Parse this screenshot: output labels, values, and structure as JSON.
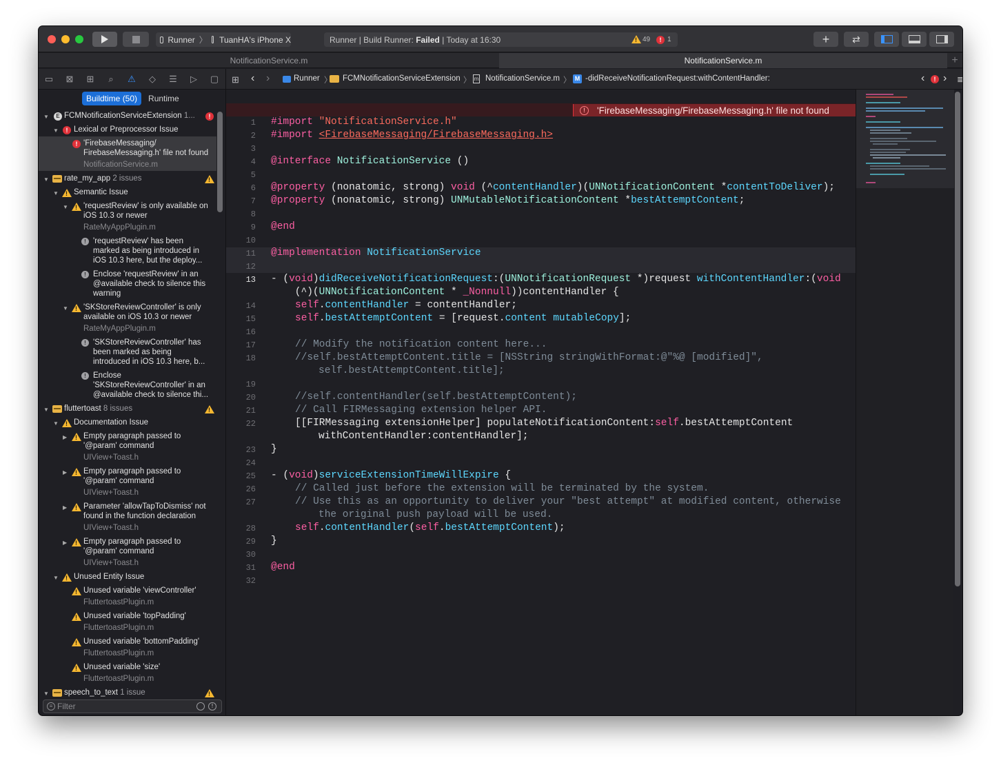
{
  "toolbar": {
    "scheme": "Runner",
    "device": "TuanHA's iPhone X",
    "status_prefix": "Runner | Build Runner:",
    "status_result": "Failed",
    "status_time": "| Today at 16:30",
    "warning_count": "49",
    "error_count": "1"
  },
  "tabs": [
    "NotificationService.m",
    "NotificationService.m"
  ],
  "issue_navigator": {
    "segments": [
      "Buildtime (50)",
      "Runtime"
    ],
    "filter_placeholder": "Filter",
    "groups": [
      {
        "name": "FCMNotificationServiceExtension",
        "count": "1...",
        "status": "error"
      },
      {
        "name": "rate_my_app",
        "count": "2 issues",
        "status": "warning"
      },
      {
        "name": "fluttertoast",
        "count": "8 issues",
        "status": "warning"
      },
      {
        "name": "speech_to_text",
        "count": "1 issue",
        "status": "warning"
      }
    ],
    "rows": {
      "lexical": "Lexical or Preprocessor Issue",
      "fm_err_1": "'FirebaseMessaging/",
      "fm_err_2": "FirebaseMessaging.h' file not found",
      "fm_file": "NotificationService.m",
      "semantic": "Semantic Issue",
      "rr_1": "'requestReview' is only available on",
      "rr_2": "iOS 10.3 or newer",
      "rr_file": "RateMyAppPlugin.m",
      "rr_n1": "'requestReview' has been",
      "rr_n2": "marked as being introduced in",
      "rr_n3": "iOS 10.3 here, but the deploy...",
      "rr_e1": "Enclose 'requestReview' in an",
      "rr_e2": "@available check to silence this",
      "rr_e3": "warning",
      "sk_1": "'SKStoreReviewController' is only",
      "sk_2": "available on iOS 10.3 or newer",
      "sk_file": "RateMyAppPlugin.m",
      "sk_n1": "'SKStoreReviewController' has",
      "sk_n2": "been marked as being",
      "sk_n3": "introduced in iOS 10.3 here, b...",
      "sk_e1": "Enclose",
      "sk_e2": "'SKStoreReviewController' in an",
      "sk_e3": "@available check to silence thi...",
      "doc": "Documentation Issue",
      "ep1_1": "Empty paragraph passed to",
      "ep1_2": "'@param' command",
      "ep1_f": "UIView+Toast.h",
      "ep2_1": "Empty paragraph passed to",
      "ep2_2": "'@param' command",
      "ep2_f": "UIView+Toast.h",
      "pa_1": "Parameter 'allowTapToDismiss' not",
      "pa_2": "found in the function declaration",
      "pa_f": "UIView+Toast.h",
      "ep3_1": "Empty paragraph passed to",
      "ep3_2": "'@param' command",
      "ep3_f": "UIView+Toast.h",
      "unused": "Unused Entity Issue",
      "u1": "Unused variable 'viewController'",
      "u1_f": "FluttertoastPlugin.m",
      "u2": "Unused variable 'topPadding'",
      "u2_f": "FluttertoastPlugin.m",
      "u3": "Unused variable 'bottomPadding'",
      "u3_f": "FluttertoastPlugin.m",
      "u4": "Unused variable 'size'",
      "u4_f": "FluttertoastPlugin.m"
    }
  },
  "jump_bar": {
    "project": "Runner",
    "group": "FCMNotificationServiceExtension",
    "file": "NotificationService.m",
    "symbol": "-didReceiveNotificationRequest:withContentHandler:"
  },
  "editor": {
    "line_numbers": [
      "1",
      "2",
      "3",
      "4",
      "5",
      "6",
      "7",
      "8",
      "9",
      "10",
      "11",
      "12",
      "13",
      "14",
      "15",
      "16",
      "17",
      "18",
      "19",
      "20",
      "21",
      "22",
      "23",
      "24",
      "25",
      "26",
      "27",
      "28",
      "29",
      "30",
      "31",
      "32"
    ],
    "error_message": "'FirebaseMessaging/FirebaseMessaging.h' file not found",
    "code": {
      "l1a": "#import ",
      "l1b": "\"NotificationService.h\"",
      "l2a": "#import ",
      "l2b": "<FirebaseMessaging/FirebaseMessaging.h>",
      "l4a": "@interface ",
      "l4b": "NotificationService",
      "l4c": " ()",
      "l6a": "@property ",
      "l6b": "(nonatomic, strong) ",
      "l6c": "void",
      "l6d": " (^",
      "l6e": "contentHandler",
      "l6f": ")(",
      "l6g": "UNNotificationContent",
      "l6h": " *",
      "l6i": "contentToDeliver",
      "l6j": ");",
      "l7a": "@property ",
      "l7b": "(nonatomic, strong) ",
      "l7c": "UNMutableNotificationContent",
      "l7d": " *",
      "l7e": "bestAttemptContent",
      "l7f": ";",
      "l9": "@end",
      "l11a": "@implementation ",
      "l11b": "NotificationService",
      "l13a": "- (",
      "l13b": "void",
      "l13c": ")",
      "l13d": "didReceiveNotificationRequest",
      "l13e": ":(",
      "l13f": "UNNotificationRequest",
      "l13g": " *)request ",
      "l13h": "withContentHandler",
      "l13i": ":(",
      "l13j": "void",
      "l13k": "    (^)(",
      "l13l": "UNNotificationContent",
      "l13m": " * ",
      "l13n": "_Nonnull",
      "l13o": "))contentHandler {",
      "l14a": "self",
      "l14b": ".",
      "l14c": "contentHandler",
      "l14d": " = contentHandler;",
      "l15a": "self",
      "l15b": ".",
      "l15c": "bestAttemptContent",
      "l15d": " = [request.",
      "l15e": "content",
      "l15f": " ",
      "l15g": "mutableCopy",
      "l15h": "];",
      "l17": "// Modify the notification content here...",
      "l18a": "//self.bestAttemptContent.title = [NSString stringWithFormat:@\"%@ [modified]\",",
      "l18b": "self.bestAttemptContent.title];",
      "l20": "//self.contentHandler(self.bestAttemptContent);",
      "l21": "// Call FIRMessaging extension helper API.",
      "l22a": "[[FIRMessaging extensionHelper] populateNotificationContent:",
      "l22b": "self",
      "l22c": ".bestAttemptContent",
      "l22d": "withContentHandler:contentHandler];",
      "l23": "}",
      "l25a": "- (",
      "l25b": "void",
      "l25c": ")",
      "l25d": "serviceExtensionTimeWillExpire",
      "l25e": " {",
      "l26": "// Called just before the extension will be terminated by the system.",
      "l27a": "// Use this as an opportunity to deliver your \"best attempt\" at modified content, otherwise",
      "l27b": "the original push payload will be used.",
      "l28a": "self",
      "l28b": ".",
      "l28c": "contentHandler",
      "l28d": "(",
      "l28e": "self",
      "l28f": ".",
      "l28g": "bestAttemptContent",
      "l28h": ");",
      "l29": "}",
      "l31": "@end"
    }
  },
  "colors": {
    "accent": "#1c6fd8",
    "error": "#e0323a",
    "warning": "#f5b731",
    "keyword": "#fc5fa3",
    "string": "#fc6a5d",
    "comment": "#7f8c98",
    "type": "#5dd8ff"
  },
  "icons": [
    "play-icon",
    "stop-icon",
    "add-icon",
    "swap-icon",
    "navigator-toggle-icon",
    "debug-area-icon",
    "inspector-toggle-icon",
    "folder-icon",
    "issue-warning-icon",
    "error-icon",
    "grid-icon",
    "back-icon",
    "forward-icon",
    "method-icon",
    "filter-icon"
  ]
}
